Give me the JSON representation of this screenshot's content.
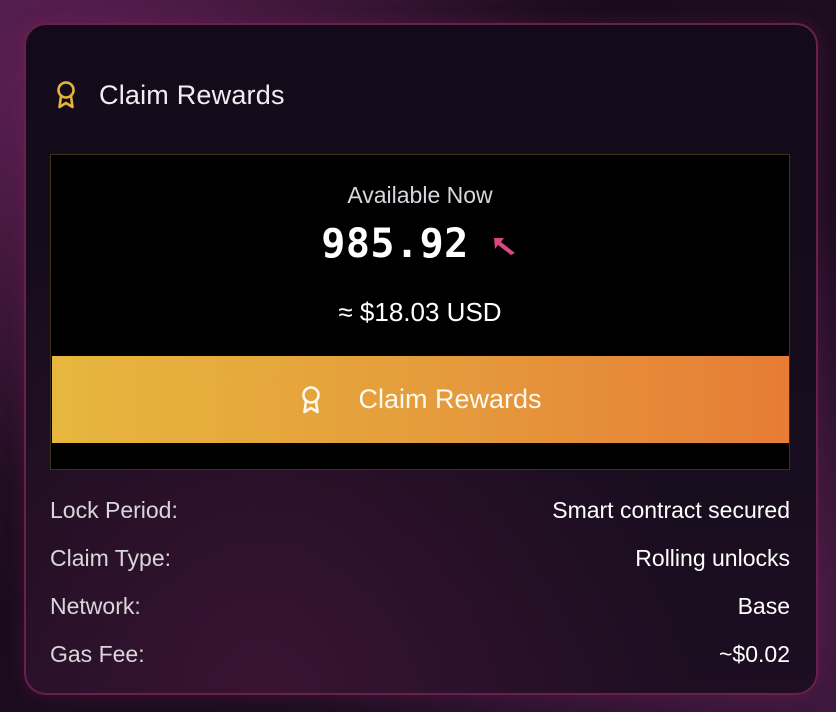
{
  "card": {
    "title": "Claim Rewards",
    "title_icon": "award-ribbon-icon"
  },
  "balance": {
    "label": "Available Now",
    "amount": "985.92",
    "token_icon": "token-logo-icon",
    "usd_value": "≈ $18.03 USD"
  },
  "claim_button": {
    "label": "Claim Rewards",
    "icon": "award-ribbon-icon"
  },
  "details": [
    {
      "key": "Lock Period:",
      "value": "Smart contract secured"
    },
    {
      "key": "Claim Type:",
      "value": "Rolling unlocks"
    },
    {
      "key": "Network:",
      "value": "Base"
    },
    {
      "key": "Gas Fee:",
      "value": "~$0.02"
    }
  ],
  "colors": {
    "accent_gold": "#e6b73d",
    "accent_orange": "#e67c35",
    "card_border": "#6a1f4d",
    "token_pink": "#d9477f",
    "icon_gold": "#e6b43a"
  }
}
